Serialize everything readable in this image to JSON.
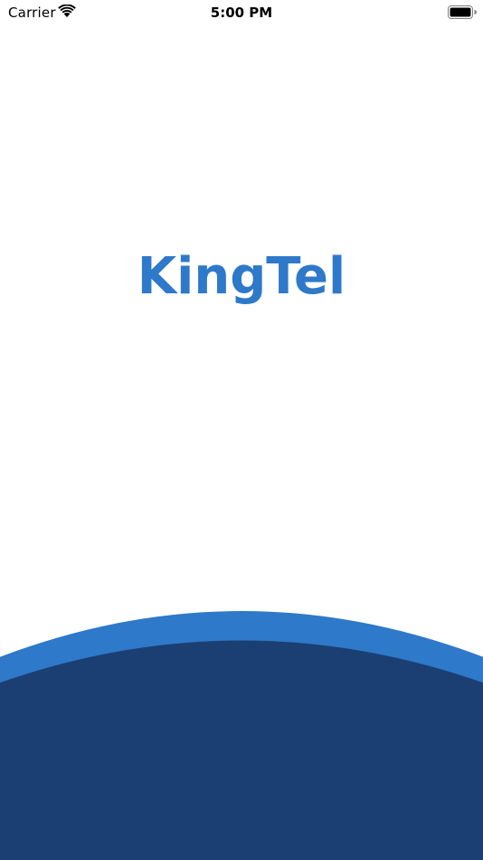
{
  "status_bar": {
    "carrier": "Carrier",
    "time": "5:00 PM",
    "wifi_icon": "wifi-icon",
    "battery_icon": "battery-icon"
  },
  "splash": {
    "logo_text": "KingTel"
  },
  "colors": {
    "brand_blue": "#2e79c9",
    "navy": "#1b3f72",
    "background": "#ffffff"
  }
}
